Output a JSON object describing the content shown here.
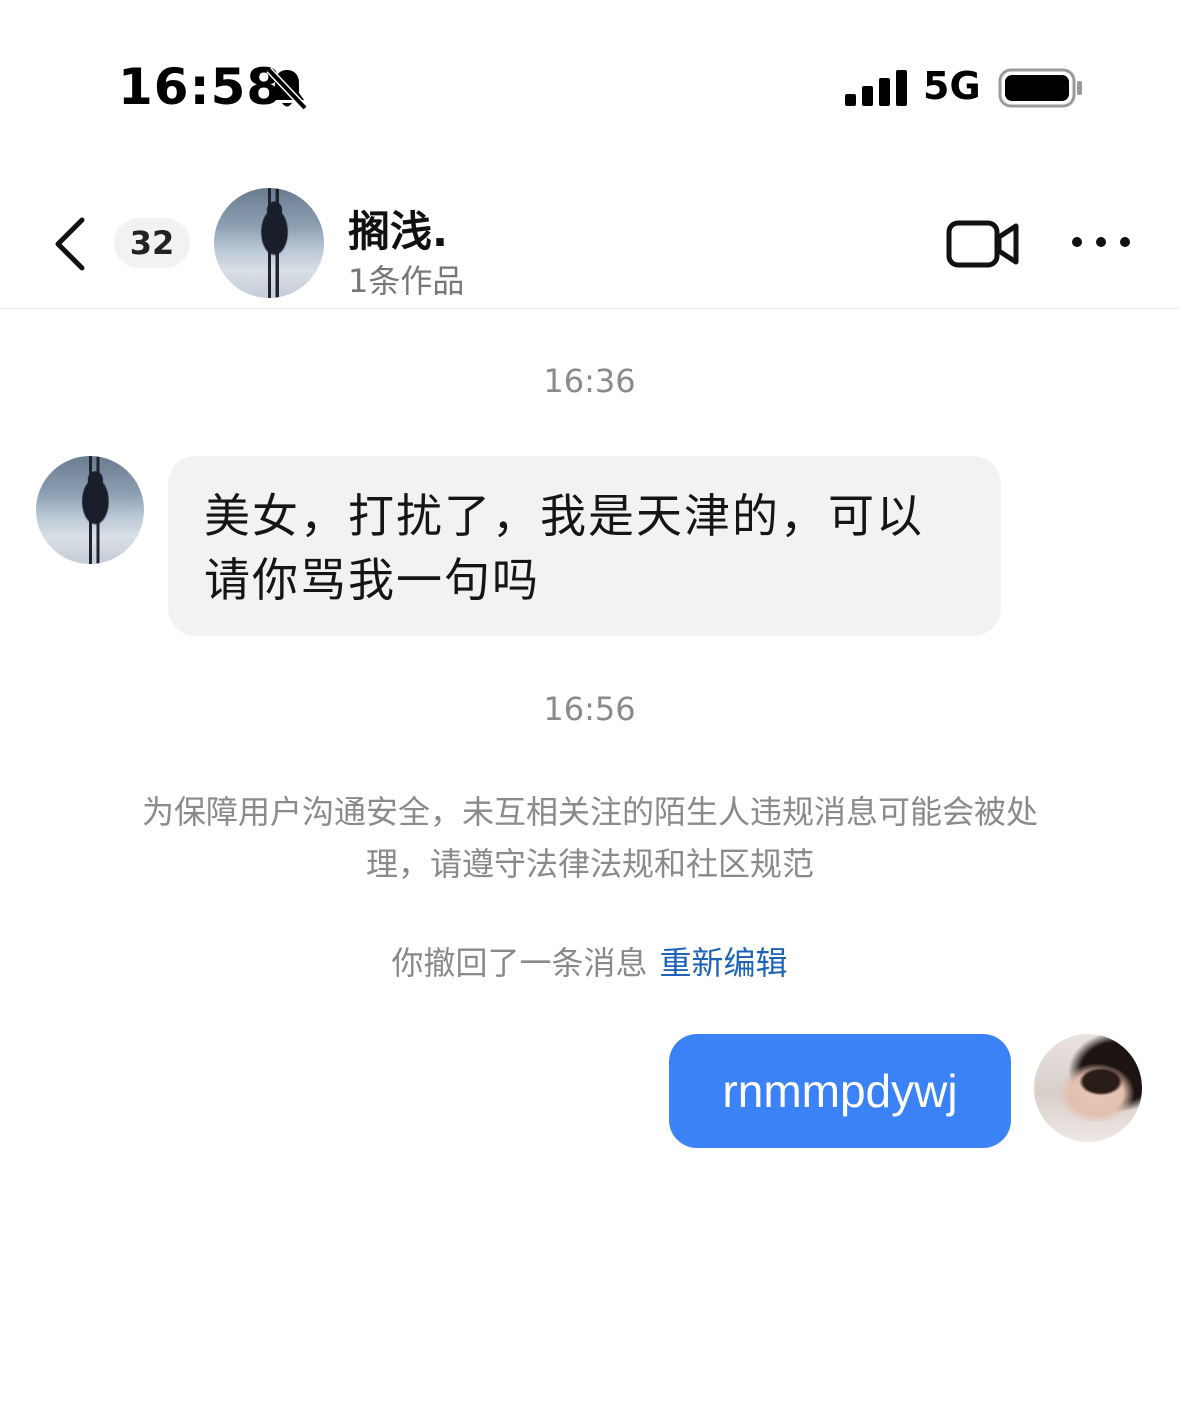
{
  "status_bar": {
    "time": "16:58",
    "network": "5G",
    "icons": [
      "bell-slash-icon",
      "signal-bars-icon",
      "battery-icon"
    ]
  },
  "header": {
    "unread_count": "32",
    "contact_name": "搁浅.",
    "contact_subtitle": "1条作品",
    "icons": [
      "chevron-left-icon",
      "video-camera-icon",
      "more-dots-icon"
    ]
  },
  "chat": {
    "messages": [
      {
        "timestamp": "16:36",
        "direction": "incoming",
        "text": "美女，打扰了，我是天津的，可以请你骂我一句吗"
      },
      {
        "timestamp": "16:56",
        "direction": "outgoing",
        "text": "rnmmpdywj"
      }
    ],
    "system_notice": "为保障用户沟通安全，未互相关注的陌生人违规消息可能会被处理，请遵守法律法规和社区规范",
    "recall_text": "你撤回了一条消息",
    "reedit_label": "重新编辑"
  },
  "colors": {
    "outgoing_bubble": "#3a82f6",
    "incoming_bubble": "#f2f2f5",
    "link": "#1e63b8",
    "muted_text": "#8a8a8a"
  }
}
